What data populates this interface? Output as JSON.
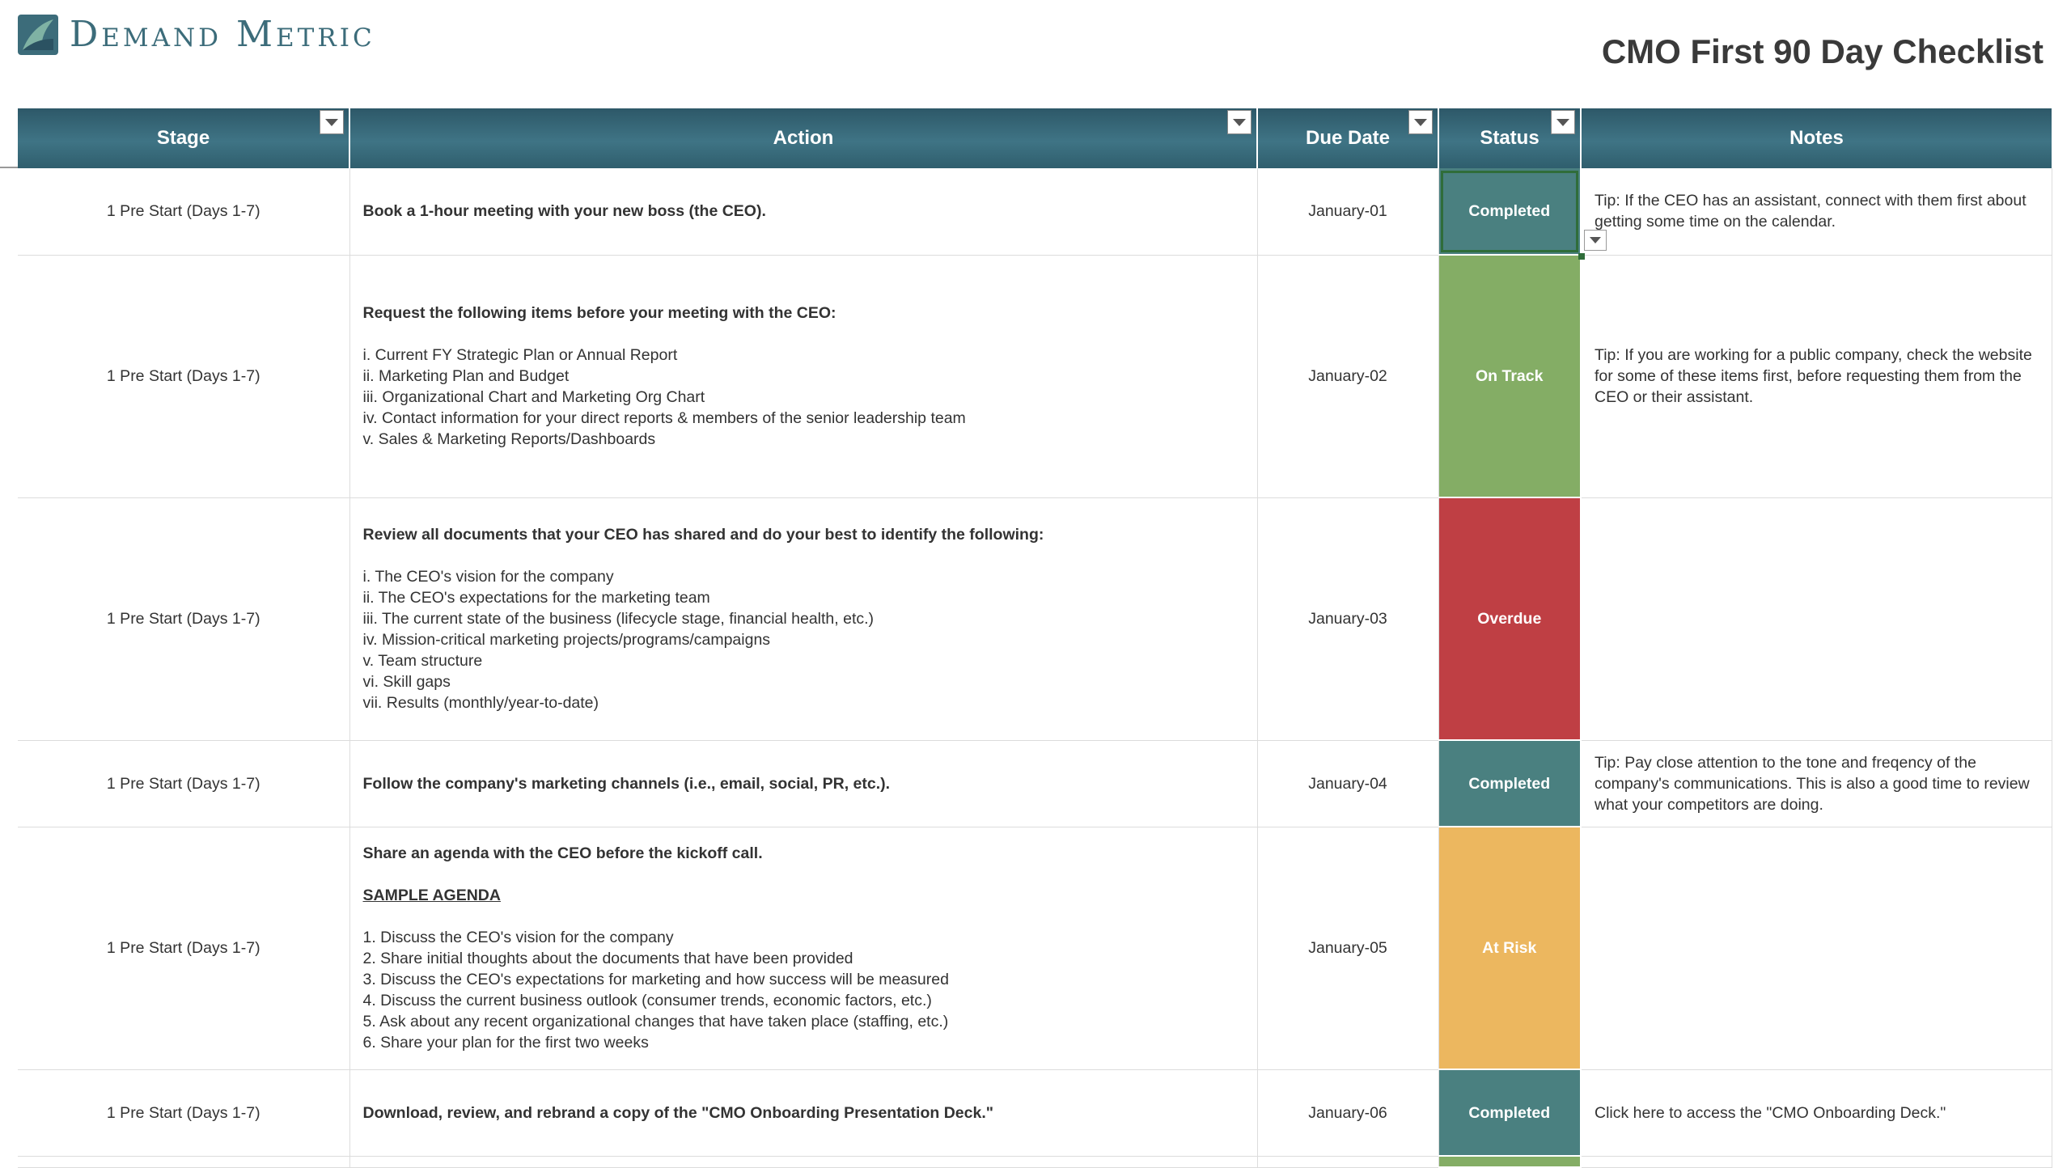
{
  "brand": {
    "name": "Demand Metric",
    "logo_icon": "demand-metric-logo"
  },
  "title": "CMO First 90 Day Checklist",
  "columns": [
    {
      "label": "Stage",
      "filter": true
    },
    {
      "label": "Action",
      "filter": true
    },
    {
      "label": "Due Date",
      "filter": true
    },
    {
      "label": "Status",
      "filter": true
    },
    {
      "label": "Notes",
      "filter": false
    }
  ],
  "status_colors": {
    "Completed": "#4a8080",
    "On Track": "#84ad65",
    "Overdue": "#bf3f44",
    "At Risk": "#ecb75f"
  },
  "rows": [
    {
      "stage": "1 Pre Start (Days 1-7)",
      "action_title": "Book a 1-hour meeting with your new boss (the CEO).",
      "due": "January-01",
      "status": "Completed",
      "notes": "Tip: If the CEO has an assistant, connect with them first about getting some time on the calendar."
    },
    {
      "stage": "1 Pre Start (Days 1-7)",
      "action_title": "Request the following items before your meeting with the CEO:",
      "action_items": [
        "i. Current FY Strategic Plan or Annual Report",
        "ii. Marketing Plan and Budget",
        "iii. Organizational Chart and Marketing Org Chart",
        "iv. Contact information for your direct reports & members of the senior leadership team",
        "v. Sales & Marketing Reports/Dashboards"
      ],
      "due": "January-02",
      "status": "On Track",
      "notes": "Tip: If you are working for a public company, check the website for some of these items first, before requesting them from the CEO or their assistant."
    },
    {
      "stage": "1 Pre Start (Days 1-7)",
      "action_title": "Review all documents that your CEO has shared and do your best to identify the following:",
      "action_items": [
        "i. The CEO's vision for the company",
        "ii. The CEO's expectations for the marketing team",
        "iii. The current state of the business (lifecycle stage, financial health, etc.)",
        "iv. Mission-critical marketing projects/programs/campaigns",
        "v. Team structure",
        "vi. Skill gaps",
        "vii. Results (monthly/year-to-date)"
      ],
      "due": "January-03",
      "status": "Overdue",
      "notes": ""
    },
    {
      "stage": "1 Pre Start (Days 1-7)",
      "action_title": "Follow the company's marketing channels (i.e., email, social, PR, etc.).",
      "due": "January-04",
      "status": "Completed",
      "notes": "Tip: Pay close attention to the tone and freqency of the company's communications. This is also a good time to review what your competitors are doing."
    },
    {
      "stage": "1 Pre Start (Days 1-7)",
      "action_title": "Share an agenda with the CEO before the kickoff call.",
      "action_subheading": "SAMPLE AGENDA",
      "action_items": [
        "1. Discuss the CEO's vision for the company",
        "2. Share initial thoughts about the documents that have been provided",
        "3. Discuss the CEO's expectations for marketing and how success will be measured",
        "4. Discuss the current business outlook (consumer trends, economic factors, etc.)",
        "5. Ask about any recent organizational changes that have taken place (staffing, etc.)",
        "6. Share your plan for the first two weeks"
      ],
      "due": "January-05",
      "status": "At Risk",
      "notes": ""
    },
    {
      "stage": "1 Pre Start (Days 1-7)",
      "action_title": "Download, review, and rebrand a copy of the \"CMO Onboarding Presentation Deck.\"",
      "due": "January-06",
      "status": "Completed",
      "notes": "Click here to access the \"CMO Onboarding Deck.\""
    }
  ]
}
